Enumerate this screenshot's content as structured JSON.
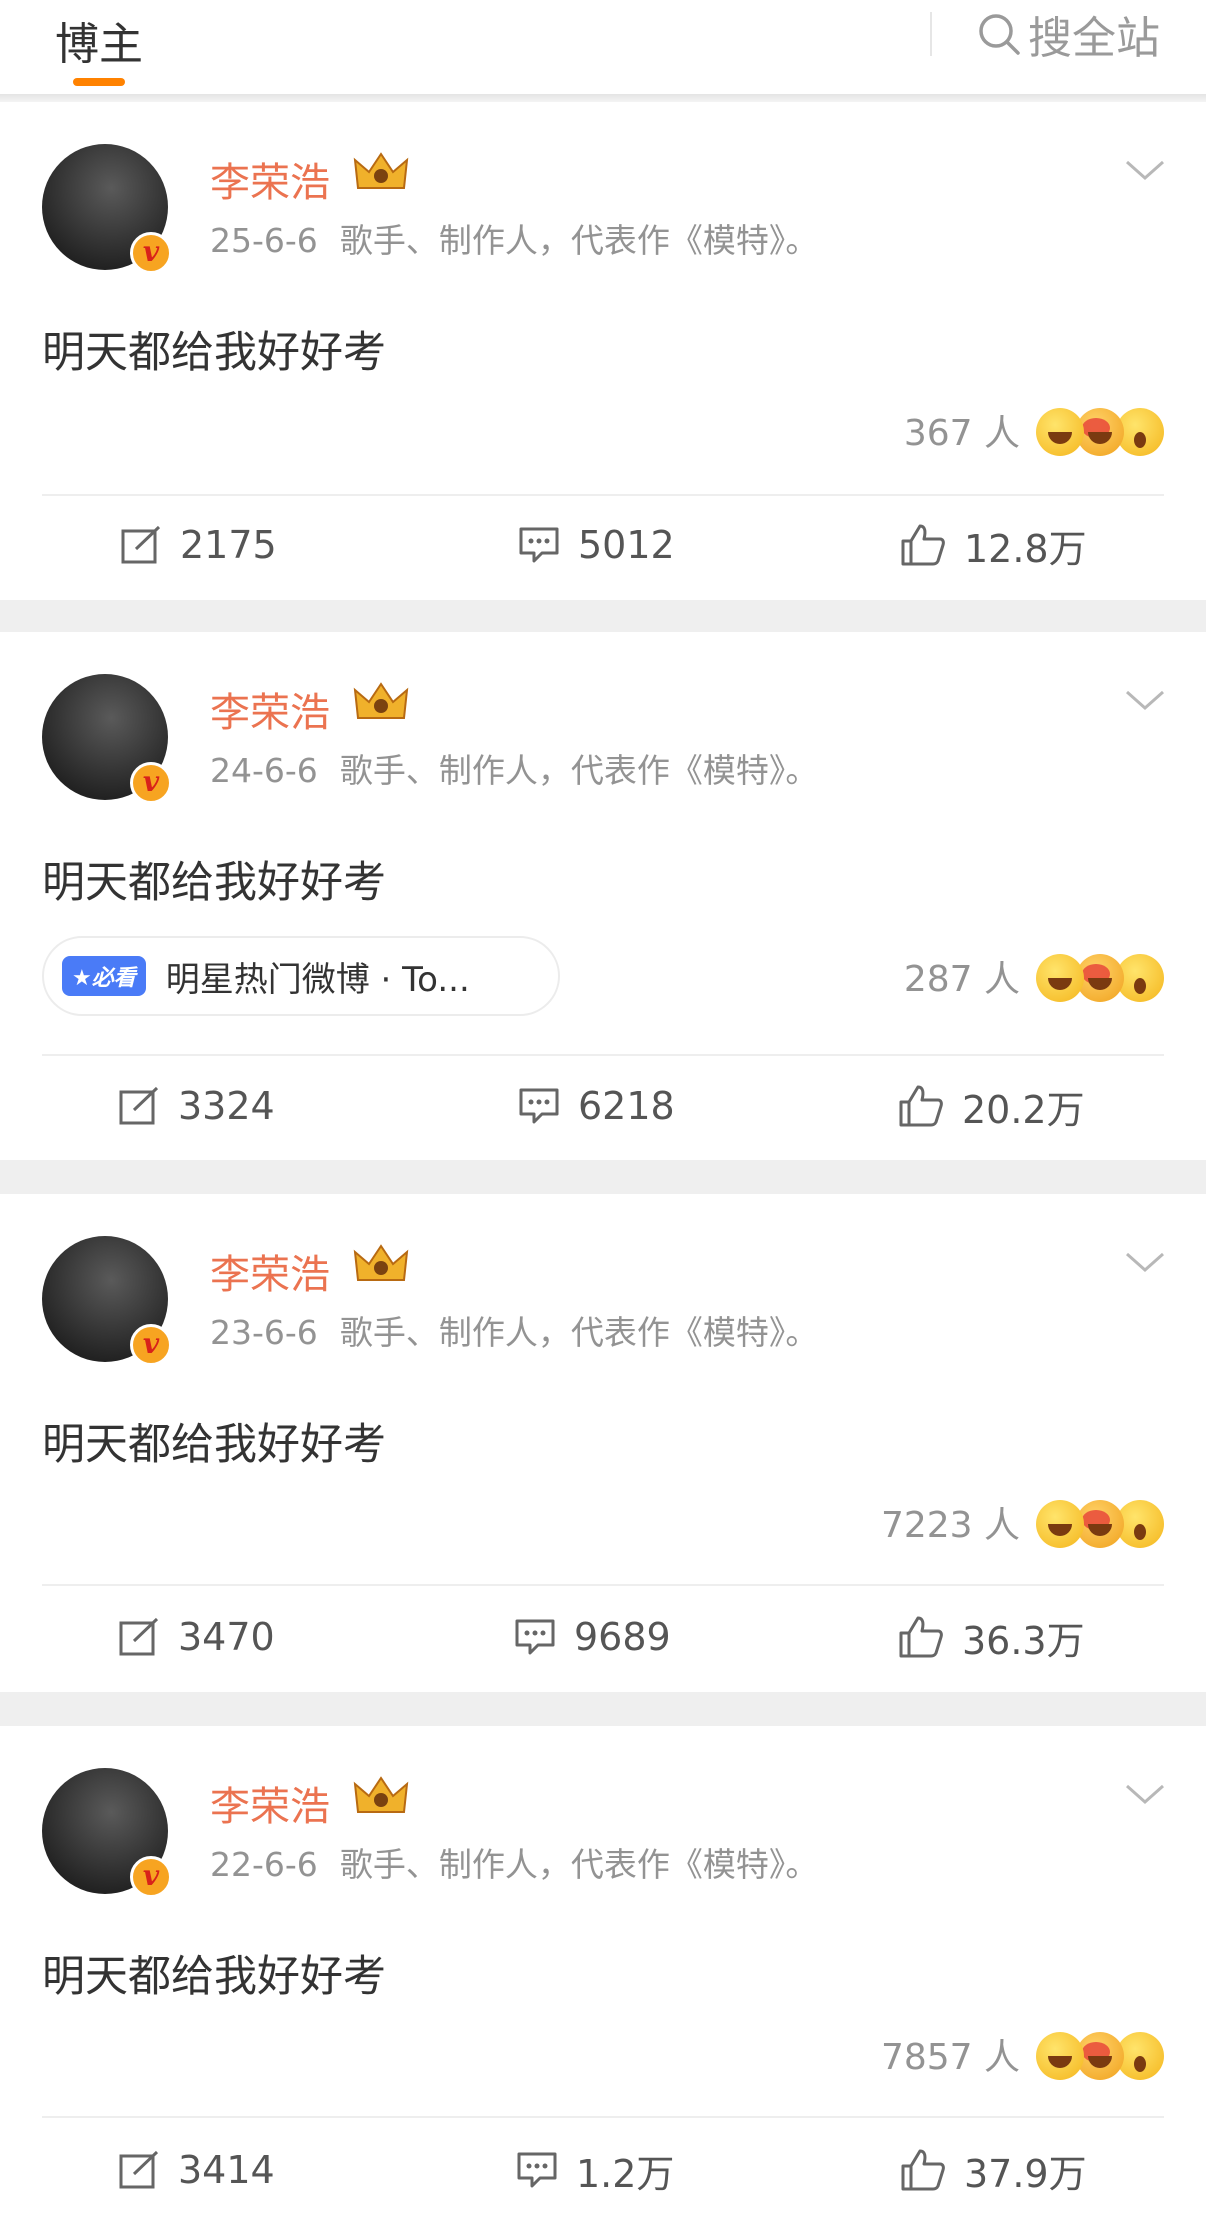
{
  "topbar": {
    "tab_label": "博主",
    "search_label": "搜全站"
  },
  "posts": [
    {
      "name": "李荣浩",
      "date": "25-6-6",
      "bio": "歌手、制作人，代表作《模特》。",
      "text": "明天都给我好好考",
      "reaction_count": "367 人",
      "repost": "2175",
      "comment": "5012",
      "like": "12.8万",
      "tag": null
    },
    {
      "name": "李荣浩",
      "date": "24-6-6",
      "bio": "歌手、制作人，代表作《模特》。",
      "text": "明天都给我好好考",
      "reaction_count": "287 人",
      "repost": "3324",
      "comment": "6218",
      "like": "20.2万",
      "tag": {
        "badge": "★必看",
        "label": "明星热门微博 · To..."
      }
    },
    {
      "name": "李荣浩",
      "date": "23-6-6",
      "bio": "歌手、制作人，代表作《模特》。",
      "text": "明天都给我好好考",
      "reaction_count": "7223 人",
      "repost": "3470",
      "comment": "9689",
      "like": "36.3万",
      "tag": null
    },
    {
      "name": "李荣浩",
      "date": "22-6-6",
      "bio": "歌手、制作人，代表作《模特》。",
      "text": "明天都给我好好考",
      "reaction_count": "7857 人",
      "repost": "3414",
      "comment": "1.2万",
      "like": "37.9万",
      "tag": null
    }
  ],
  "icons": {
    "search": "search-icon",
    "chevron": "chevron-down-icon",
    "repost": "repost-icon",
    "comment": "comment-icon",
    "like": "like-icon",
    "crown": "crown-badge-icon",
    "verified": "verified-v-icon"
  },
  "colors": {
    "accent": "#ff8200",
    "username": "#eb7350",
    "muted": "#939393"
  }
}
